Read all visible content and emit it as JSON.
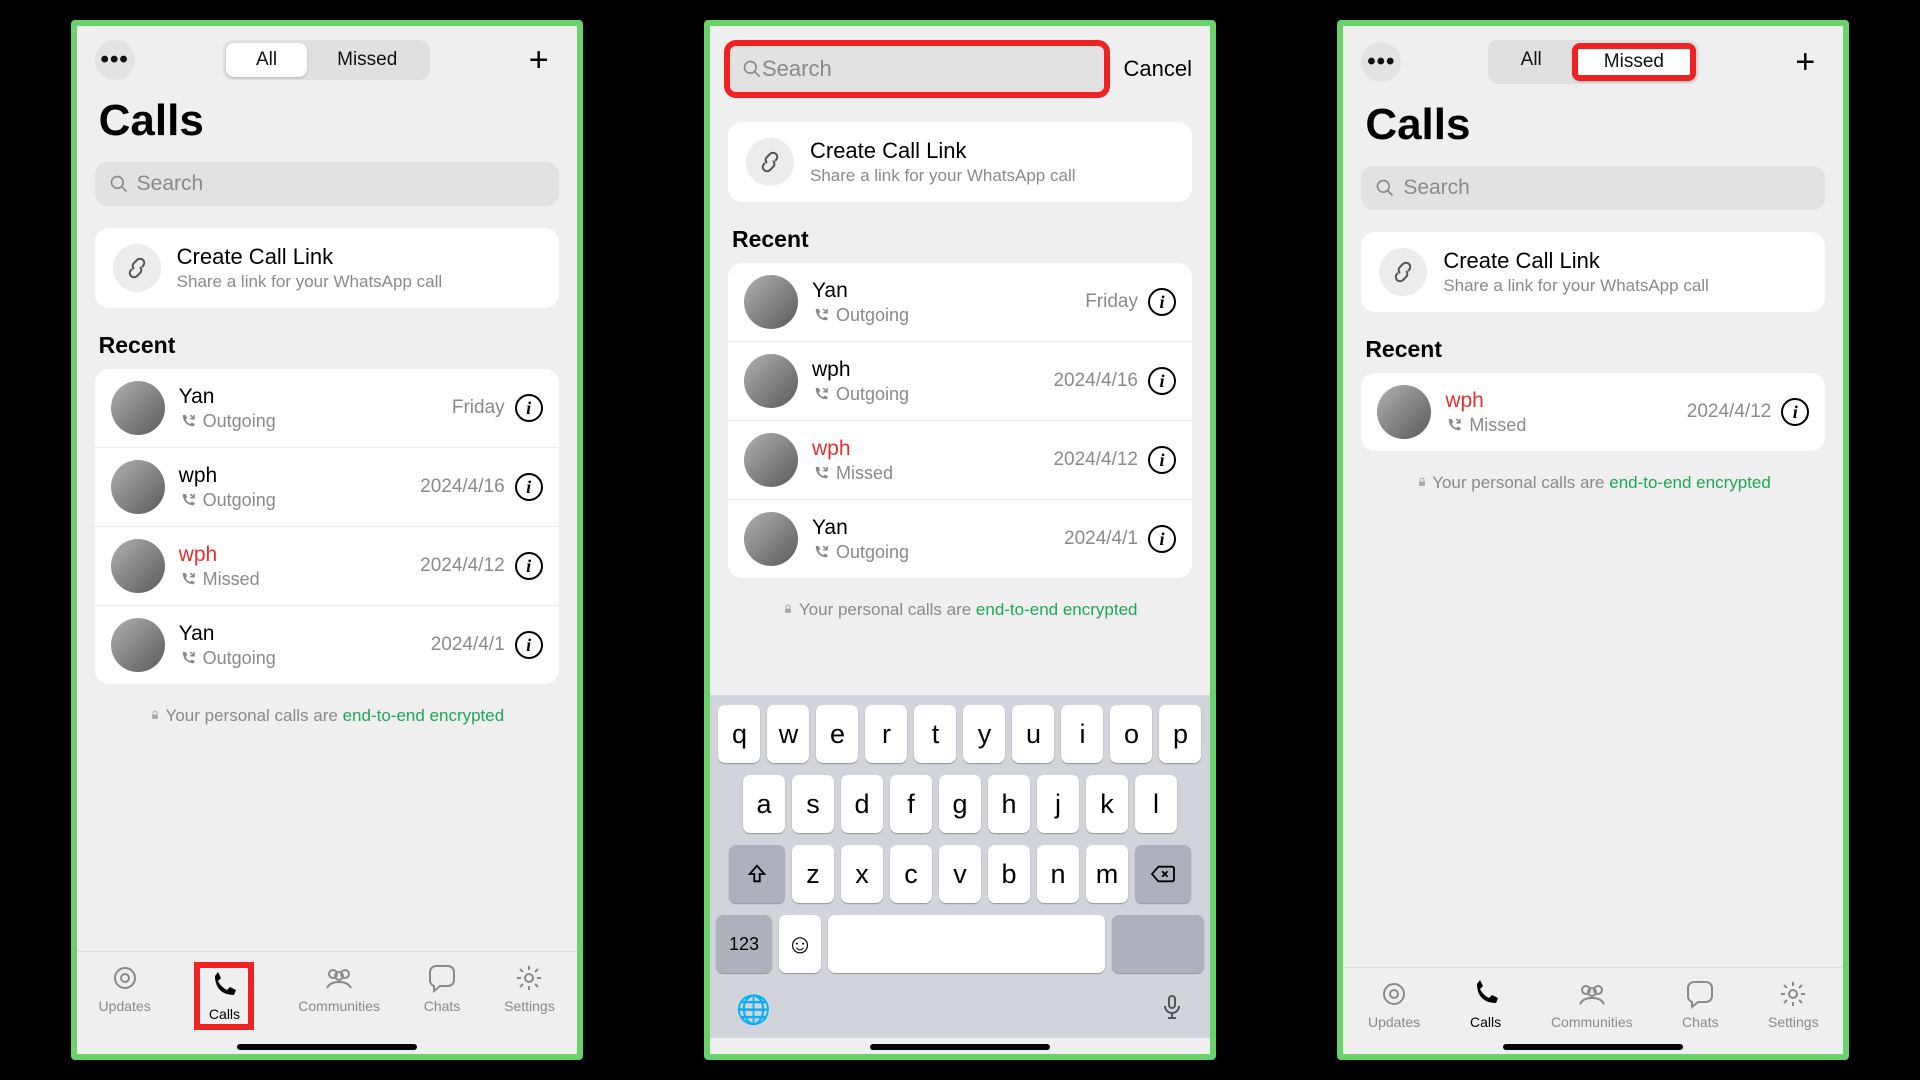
{
  "common": {
    "tabs": {
      "all": "All",
      "missed": "Missed"
    },
    "title": "Calls",
    "search_placeholder": "Search",
    "create_link": {
      "title": "Create Call Link",
      "sub": "Share a link for your WhatsApp call"
    },
    "recent_header": "Recent",
    "enc_prefix": "Your personal calls are ",
    "enc_link": "end-to-end encrypted",
    "cancel": "Cancel",
    "bottom": {
      "updates": "Updates",
      "calls": "Calls",
      "communities": "Communities",
      "chats": "Chats",
      "settings": "Settings"
    }
  },
  "screen1": {
    "active_tab": "All",
    "calls": [
      {
        "name": "Yan",
        "status": "Outgoing",
        "date": "Friday",
        "missed": false
      },
      {
        "name": "wph",
        "status": "Outgoing",
        "date": "2024/4/16",
        "missed": false
      },
      {
        "name": "wph",
        "status": "Missed",
        "date": "2024/4/12",
        "missed": true
      },
      {
        "name": "Yan",
        "status": "Outgoing",
        "date": "2024/4/1",
        "missed": false
      }
    ]
  },
  "screen2": {
    "calls": [
      {
        "name": "Yan",
        "status": "Outgoing",
        "date": "Friday",
        "missed": false
      },
      {
        "name": "wph",
        "status": "Outgoing",
        "date": "2024/4/16",
        "missed": false
      },
      {
        "name": "wph",
        "status": "Missed",
        "date": "2024/4/12",
        "missed": true
      },
      {
        "name": "Yan",
        "status": "Outgoing",
        "date": "2024/4/1",
        "missed": false
      }
    ],
    "keyboard": {
      "r1": [
        "q",
        "w",
        "e",
        "r",
        "t",
        "y",
        "u",
        "i",
        "o",
        "p"
      ],
      "r2": [
        "a",
        "s",
        "d",
        "f",
        "g",
        "h",
        "j",
        "k",
        "l"
      ],
      "r3": [
        "z",
        "x",
        "c",
        "v",
        "b",
        "n",
        "m"
      ],
      "numkey": "123"
    }
  },
  "screen3": {
    "active_tab": "Missed",
    "calls": [
      {
        "name": "wph",
        "status": "Missed",
        "date": "2024/4/12",
        "missed": true
      }
    ]
  }
}
